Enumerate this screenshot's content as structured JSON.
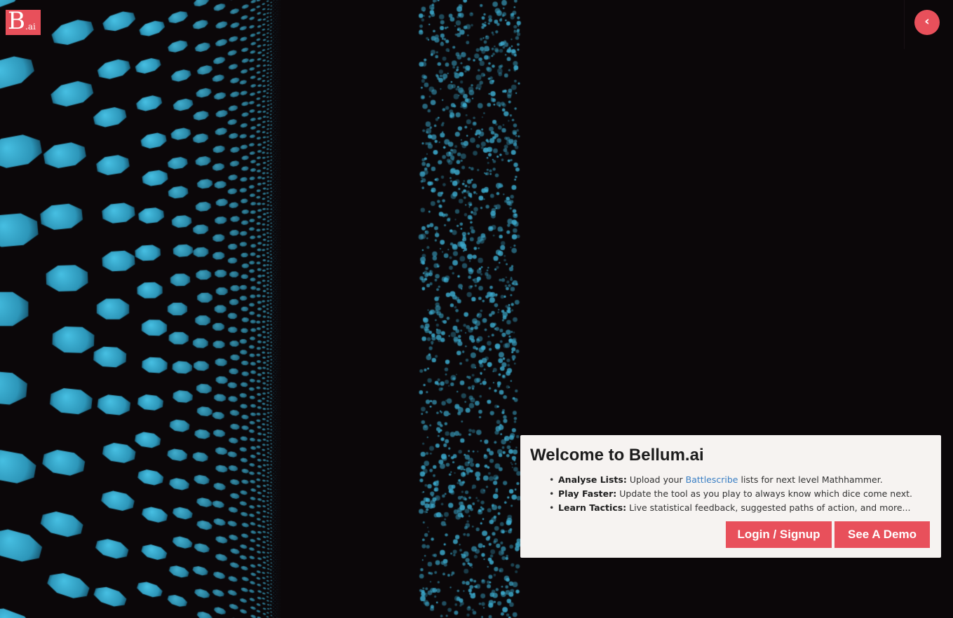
{
  "logo": {
    "letter": "B",
    "suffix": ".ai"
  },
  "header": {
    "collapse_icon": "chevron-left-icon",
    "collapse_glyph": "‹"
  },
  "background": {
    "description_free": true,
    "dot_color": "#3aa6c9",
    "bg_color": "#0b0709"
  },
  "welcome": {
    "title": "Welcome to Bellum.ai",
    "items": [
      {
        "label": "Analyse Lists:",
        "pre": "Upload your ",
        "link": "Battlescribe",
        "post": " lists for next level Mathhammer."
      },
      {
        "label": "Play Faster:",
        "pre": "Update the tool as you play to always know which dice come next.",
        "link": "",
        "post": ""
      },
      {
        "label": "Learn Tactics:",
        "pre": "Live statistical feedback, suggested paths of action, and more...",
        "link": "",
        "post": ""
      }
    ],
    "login_label": "Login / Signup",
    "demo_label": "See A Demo"
  },
  "colors": {
    "accent": "#e8505b",
    "link": "#3a7fc4",
    "panel": "#f6f3f1"
  }
}
